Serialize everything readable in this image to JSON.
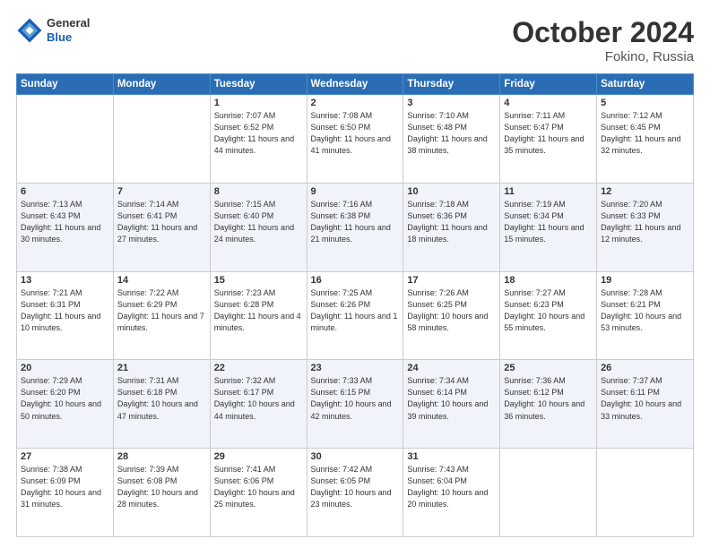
{
  "header": {
    "logo": {
      "general": "General",
      "blue": "Blue"
    },
    "month": "October 2024",
    "location": "Fokino, Russia"
  },
  "weekdays": [
    "Sunday",
    "Monday",
    "Tuesday",
    "Wednesday",
    "Thursday",
    "Friday",
    "Saturday"
  ],
  "weeks": [
    [
      {
        "day": "",
        "info": ""
      },
      {
        "day": "",
        "info": ""
      },
      {
        "day": "1",
        "info": "Sunrise: 7:07 AM\nSunset: 6:52 PM\nDaylight: 11 hours and 44 minutes."
      },
      {
        "day": "2",
        "info": "Sunrise: 7:08 AM\nSunset: 6:50 PM\nDaylight: 11 hours and 41 minutes."
      },
      {
        "day": "3",
        "info": "Sunrise: 7:10 AM\nSunset: 6:48 PM\nDaylight: 11 hours and 38 minutes."
      },
      {
        "day": "4",
        "info": "Sunrise: 7:11 AM\nSunset: 6:47 PM\nDaylight: 11 hours and 35 minutes."
      },
      {
        "day": "5",
        "info": "Sunrise: 7:12 AM\nSunset: 6:45 PM\nDaylight: 11 hours and 32 minutes."
      }
    ],
    [
      {
        "day": "6",
        "info": "Sunrise: 7:13 AM\nSunset: 6:43 PM\nDaylight: 11 hours and 30 minutes."
      },
      {
        "day": "7",
        "info": "Sunrise: 7:14 AM\nSunset: 6:41 PM\nDaylight: 11 hours and 27 minutes."
      },
      {
        "day": "8",
        "info": "Sunrise: 7:15 AM\nSunset: 6:40 PM\nDaylight: 11 hours and 24 minutes."
      },
      {
        "day": "9",
        "info": "Sunrise: 7:16 AM\nSunset: 6:38 PM\nDaylight: 11 hours and 21 minutes."
      },
      {
        "day": "10",
        "info": "Sunrise: 7:18 AM\nSunset: 6:36 PM\nDaylight: 11 hours and 18 minutes."
      },
      {
        "day": "11",
        "info": "Sunrise: 7:19 AM\nSunset: 6:34 PM\nDaylight: 11 hours and 15 minutes."
      },
      {
        "day": "12",
        "info": "Sunrise: 7:20 AM\nSunset: 6:33 PM\nDaylight: 11 hours and 12 minutes."
      }
    ],
    [
      {
        "day": "13",
        "info": "Sunrise: 7:21 AM\nSunset: 6:31 PM\nDaylight: 11 hours and 10 minutes."
      },
      {
        "day": "14",
        "info": "Sunrise: 7:22 AM\nSunset: 6:29 PM\nDaylight: 11 hours and 7 minutes."
      },
      {
        "day": "15",
        "info": "Sunrise: 7:23 AM\nSunset: 6:28 PM\nDaylight: 11 hours and 4 minutes."
      },
      {
        "day": "16",
        "info": "Sunrise: 7:25 AM\nSunset: 6:26 PM\nDaylight: 11 hours and 1 minute."
      },
      {
        "day": "17",
        "info": "Sunrise: 7:26 AM\nSunset: 6:25 PM\nDaylight: 10 hours and 58 minutes."
      },
      {
        "day": "18",
        "info": "Sunrise: 7:27 AM\nSunset: 6:23 PM\nDaylight: 10 hours and 55 minutes."
      },
      {
        "day": "19",
        "info": "Sunrise: 7:28 AM\nSunset: 6:21 PM\nDaylight: 10 hours and 53 minutes."
      }
    ],
    [
      {
        "day": "20",
        "info": "Sunrise: 7:29 AM\nSunset: 6:20 PM\nDaylight: 10 hours and 50 minutes."
      },
      {
        "day": "21",
        "info": "Sunrise: 7:31 AM\nSunset: 6:18 PM\nDaylight: 10 hours and 47 minutes."
      },
      {
        "day": "22",
        "info": "Sunrise: 7:32 AM\nSunset: 6:17 PM\nDaylight: 10 hours and 44 minutes."
      },
      {
        "day": "23",
        "info": "Sunrise: 7:33 AM\nSunset: 6:15 PM\nDaylight: 10 hours and 42 minutes."
      },
      {
        "day": "24",
        "info": "Sunrise: 7:34 AM\nSunset: 6:14 PM\nDaylight: 10 hours and 39 minutes."
      },
      {
        "day": "25",
        "info": "Sunrise: 7:36 AM\nSunset: 6:12 PM\nDaylight: 10 hours and 36 minutes."
      },
      {
        "day": "26",
        "info": "Sunrise: 7:37 AM\nSunset: 6:11 PM\nDaylight: 10 hours and 33 minutes."
      }
    ],
    [
      {
        "day": "27",
        "info": "Sunrise: 7:38 AM\nSunset: 6:09 PM\nDaylight: 10 hours and 31 minutes."
      },
      {
        "day": "28",
        "info": "Sunrise: 7:39 AM\nSunset: 6:08 PM\nDaylight: 10 hours and 28 minutes."
      },
      {
        "day": "29",
        "info": "Sunrise: 7:41 AM\nSunset: 6:06 PM\nDaylight: 10 hours and 25 minutes."
      },
      {
        "day": "30",
        "info": "Sunrise: 7:42 AM\nSunset: 6:05 PM\nDaylight: 10 hours and 23 minutes."
      },
      {
        "day": "31",
        "info": "Sunrise: 7:43 AM\nSunset: 6:04 PM\nDaylight: 10 hours and 20 minutes."
      },
      {
        "day": "",
        "info": ""
      },
      {
        "day": "",
        "info": ""
      }
    ]
  ]
}
